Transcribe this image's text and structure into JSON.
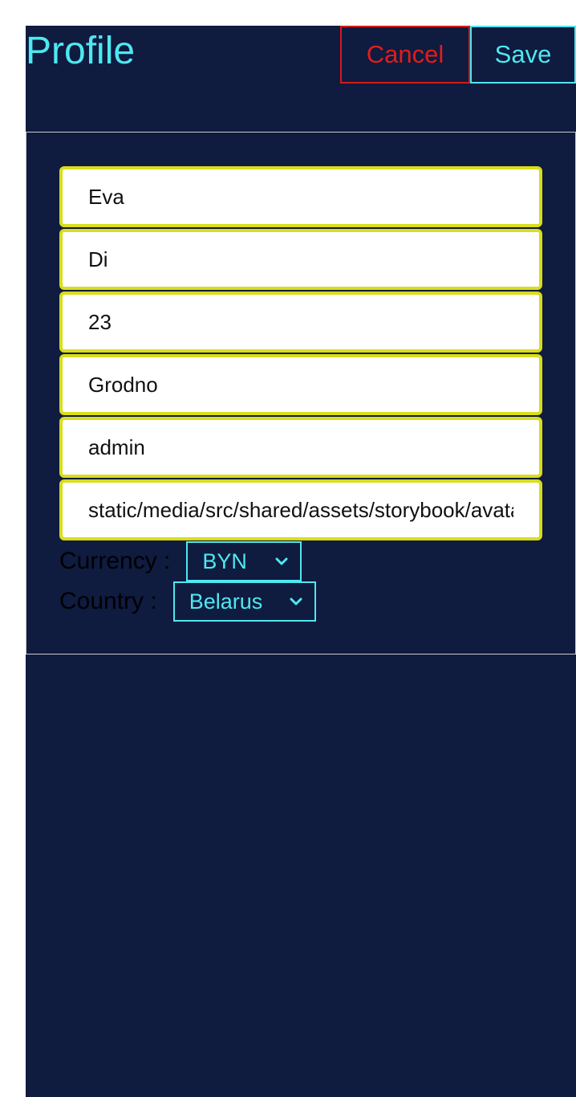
{
  "header": {
    "title": "Profile",
    "cancel_label": "Cancel",
    "save_label": "Save"
  },
  "form": {
    "first_name": "Eva",
    "last_name": "Di",
    "age": "23",
    "city": "Grodno",
    "username": "admin",
    "avatar": "static/media/src/shared/assets/storybook/avatar.jpg",
    "currency": {
      "label": "Currency :",
      "value": "BYN"
    },
    "country": {
      "label": "Country :",
      "value": "Belarus"
    }
  },
  "icons": {
    "currency_chevron": "chevron-down-icon",
    "country_chevron": "chevron-down-icon"
  },
  "colors": {
    "background": "#0f1b3f",
    "accent": "#4ee8f0",
    "danger": "#e21c1c",
    "field_border": "#d9dd1a"
  }
}
